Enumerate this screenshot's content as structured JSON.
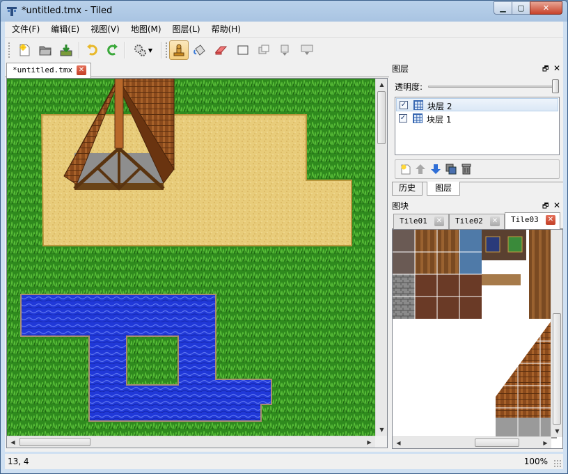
{
  "window": {
    "title": "*untitled.tmx - Tiled",
    "min_glyph": "▁",
    "max_glyph": "▢",
    "close_glyph": "✕"
  },
  "menu": [
    "文件(F)",
    "编辑(E)",
    "视图(V)",
    "地图(M)",
    "图层(L)",
    "帮助(H)"
  ],
  "toolbar": {
    "buttons": [
      "new-file-icon",
      "open-file-icon",
      "save-file-icon",
      "undo-icon",
      "redo-icon",
      "commands-icon",
      "stamp-brush-icon",
      "bucket-fill-icon",
      "eraser-icon",
      "rectangle-select-icon",
      "move-icon",
      "crop-icon",
      "resize-icon"
    ],
    "active": "stamp-brush-icon"
  },
  "document": {
    "tab_label": "*untitled.tmx",
    "tab_close": "✕"
  },
  "layers_panel": {
    "title": "图层",
    "float_glyph": "🗗",
    "close_glyph": "✕",
    "opacity_label": "透明度:",
    "opacity_value": 1.0,
    "layers": [
      {
        "name": "块层 2",
        "visible": true,
        "selected": true
      },
      {
        "name": "块层 1",
        "visible": true,
        "selected": false
      }
    ],
    "check_glyph": "✓"
  },
  "bottom_tabs": {
    "history": "历史",
    "layers": "图层",
    "active": "图层"
  },
  "tileset_panel": {
    "title": "图块",
    "float_glyph": "🗗",
    "close_glyph": "✕",
    "tabs": [
      "Tile01",
      "Tile02",
      "Tile03"
    ],
    "active_tab": "Tile03",
    "close_glyph_tab": "✕"
  },
  "status": {
    "coords": "13, 4",
    "zoom": "100%"
  },
  "colors": {
    "grass": "#2f8a1e",
    "sand": "#e8cc7a",
    "water": "#2038d8",
    "roof": "#8a4a1c"
  }
}
